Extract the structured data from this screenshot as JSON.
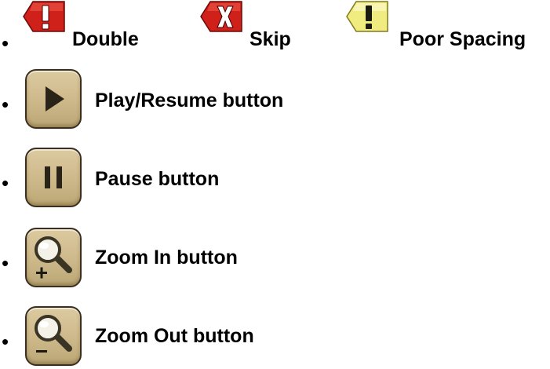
{
  "legend": {
    "flags": [
      {
        "icon": "red-exclamation-flag-icon",
        "label": "Double",
        "color": "#d0201a"
      },
      {
        "icon": "red-x-flag-icon",
        "label": "Skip",
        "color": "#d0201a"
      },
      {
        "icon": "yellow-exclamation-flag-icon",
        "label": "Poor Spacing",
        "color": "#f0ec80"
      }
    ],
    "buttons": [
      {
        "icon": "play-icon",
        "label": "Play/Resume button"
      },
      {
        "icon": "pause-icon",
        "label": "Pause button"
      },
      {
        "icon": "zoom-in-icon",
        "label": "Zoom In button"
      },
      {
        "icon": "zoom-out-icon",
        "label": "Zoom Out button"
      }
    ],
    "bullet": "•"
  }
}
